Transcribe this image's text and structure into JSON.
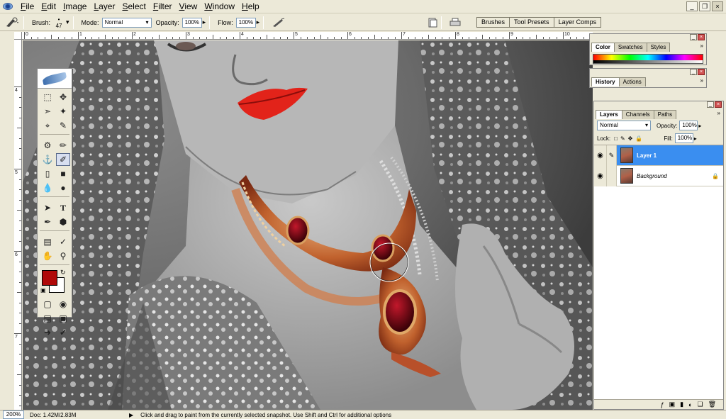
{
  "menubar": {
    "items": [
      "File",
      "Edit",
      "Image",
      "Layer",
      "Select",
      "Filter",
      "View",
      "Window",
      "Help"
    ],
    "window_buttons": [
      "_",
      "❐",
      "×"
    ]
  },
  "options": {
    "brush_label": "Brush:",
    "brush_size": "47",
    "mode_label": "Mode:",
    "mode_value": "Normal",
    "opacity_label": "Opacity:",
    "opacity_value": "100%",
    "flow_label": "Flow:",
    "flow_value": "100%"
  },
  "palette_well": {
    "tabs": [
      "Brushes",
      "Tool Presets",
      "Layer Comps"
    ]
  },
  "ruler": {
    "top": [
      "0",
      "1",
      "2",
      "3",
      "4",
      "5",
      "6",
      "7",
      "8",
      "9",
      "10"
    ],
    "left": [
      "4",
      "5",
      "6",
      "7"
    ]
  },
  "color_panel": {
    "tabs": [
      "Color",
      "Swatches",
      "Styles"
    ],
    "active": "Color"
  },
  "history_panel": {
    "tabs": [
      "History",
      "Actions"
    ],
    "active": "History"
  },
  "layers_panel": {
    "tabs": [
      "Layers",
      "Channels",
      "Paths"
    ],
    "blend_mode": "Normal",
    "opacity_label": "Opacity:",
    "opacity_value": "100%",
    "lock_label": "Lock:",
    "fill_label": "Fill:",
    "fill_value": "100%",
    "layers": [
      {
        "name": "Layer 1",
        "active": true
      },
      {
        "name": "Background",
        "active": false,
        "locked": true
      }
    ]
  },
  "colors": {
    "foreground": "#b00909",
    "background": "#ffffff",
    "selection": "#3a8ef0"
  },
  "status": {
    "zoom": "200%",
    "doc": "Doc: 1.42M/2.83M",
    "message": "Click and drag to paint from the currently selected snapshot.  Use Shift and Ctrl for additional options"
  }
}
